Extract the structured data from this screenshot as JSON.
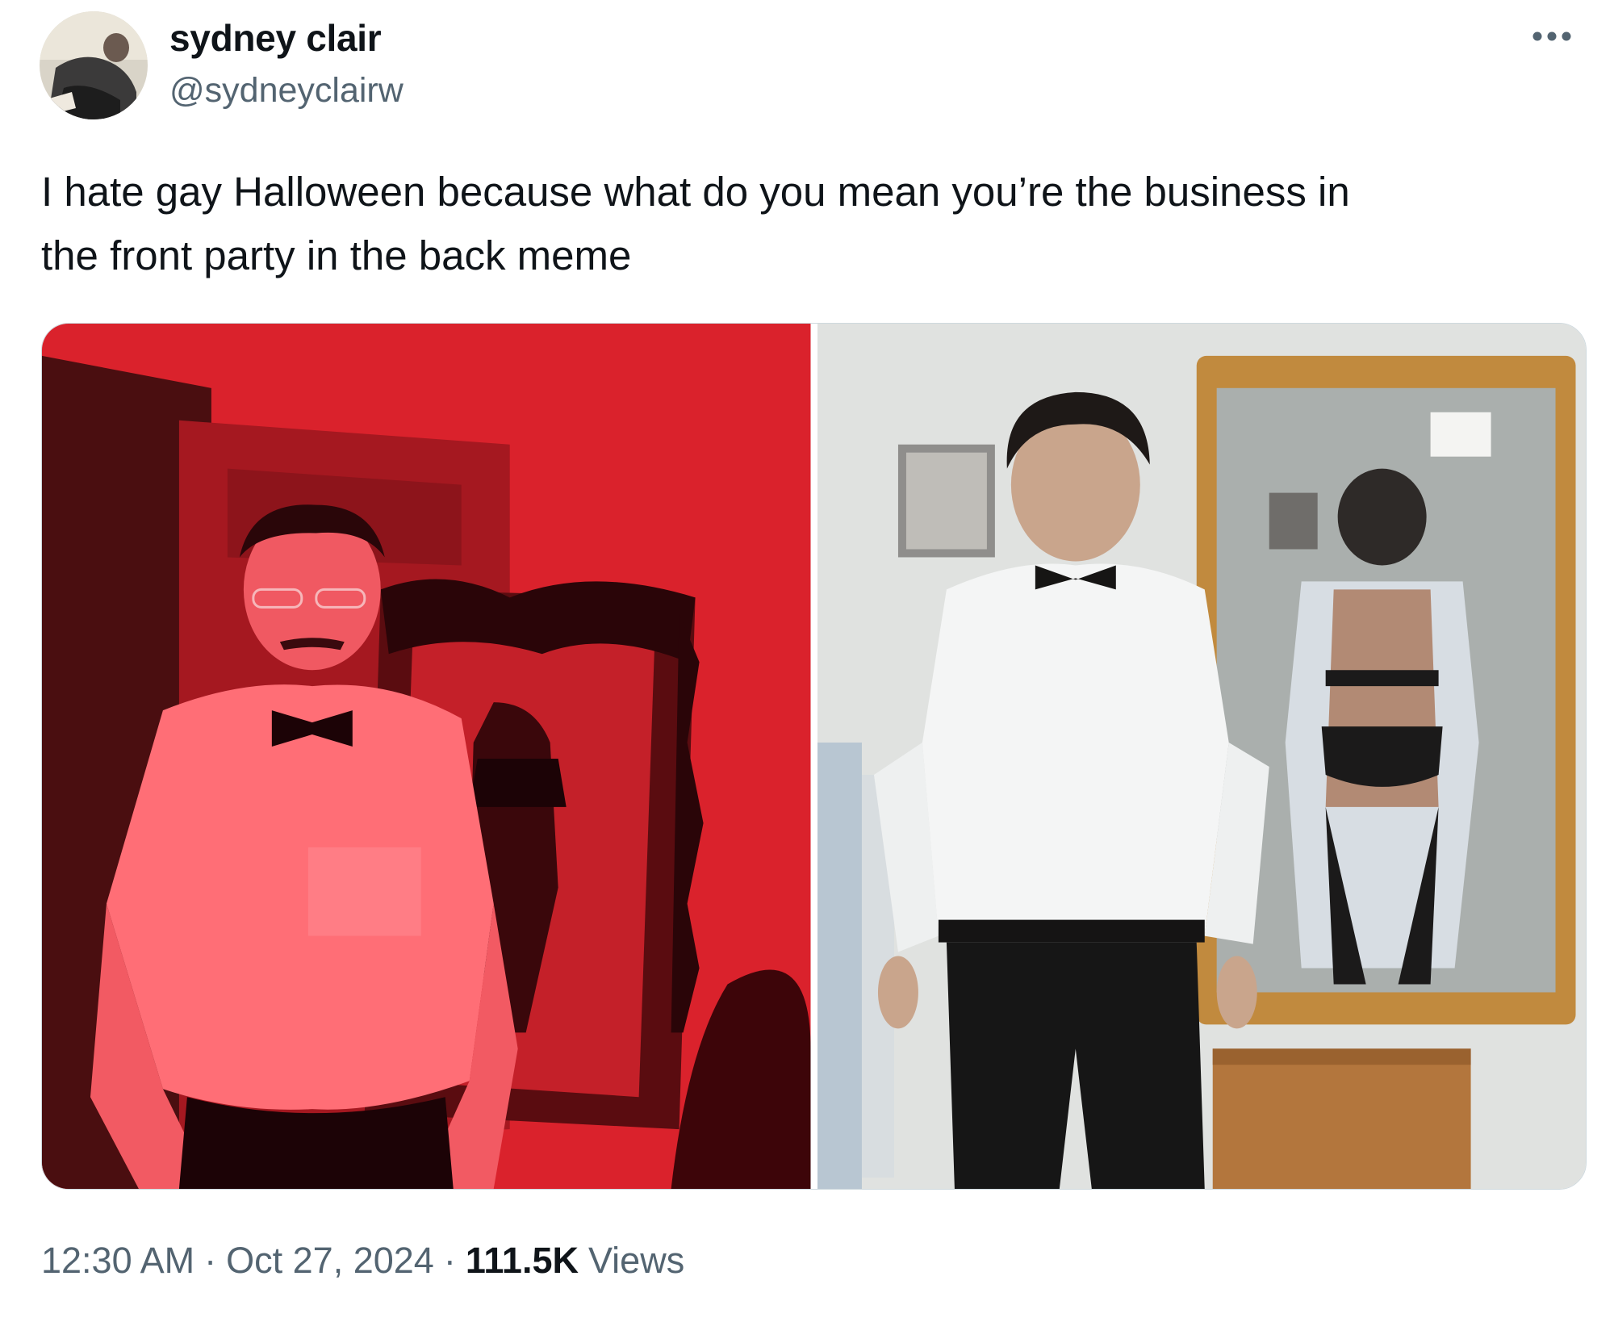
{
  "user": {
    "display_name": "sydney clair",
    "handle": "@sydneyclairw"
  },
  "tweet": {
    "text": "I hate gay Halloween because what do you mean you’re the business in\nthe front party in the back meme"
  },
  "media": {
    "count": 2
  },
  "meta": {
    "time": "12:30 AM",
    "separator": "·",
    "date": "Oct 27, 2024",
    "views_count": "111.5K",
    "views_label": "Views"
  },
  "icons": {
    "more": "more-horizontal-icon"
  },
  "colors": {
    "text_primary": "#0f1419",
    "text_secondary": "#536471",
    "left_photo_tint": "#e0262e",
    "background": "#ffffff"
  }
}
